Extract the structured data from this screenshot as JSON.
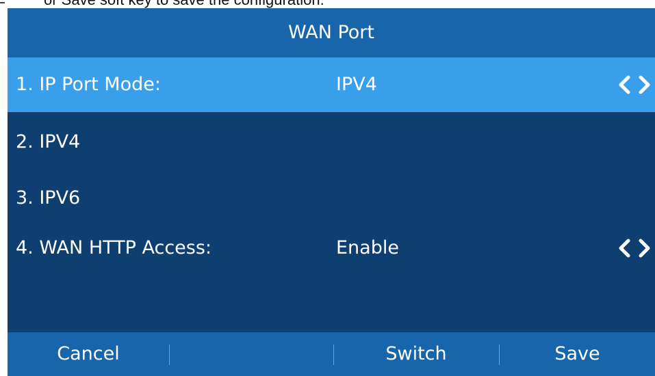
{
  "doc_snippet": {
    "text": "or Save soft key to save the configuration."
  },
  "screen": {
    "title": "WAN Port",
    "items": [
      {
        "label": "1. IP Port Mode:",
        "value": "IPV4",
        "selected": true,
        "has_arrows": true
      },
      {
        "label": "2. IPV4",
        "value": "",
        "selected": false,
        "has_arrows": false
      },
      {
        "label": "3. IPV6",
        "value": "",
        "selected": false,
        "has_arrows": false
      },
      {
        "label": "4. WAN HTTP Access:",
        "value": "Enable",
        "selected": false,
        "has_arrows": true
      }
    ],
    "softkeys": {
      "left": "Cancel",
      "middle_left": "",
      "middle_right": "Switch",
      "right": "Save"
    }
  },
  "icons": {
    "left_arrow": "chevron-left-icon",
    "right_arrow": "chevron-right-icon"
  },
  "colors": {
    "screen_bg": "#0f3e70",
    "bar_bg": "#1965ab",
    "selected_row_bg": "#3a9fea",
    "text": "#ffffff"
  }
}
